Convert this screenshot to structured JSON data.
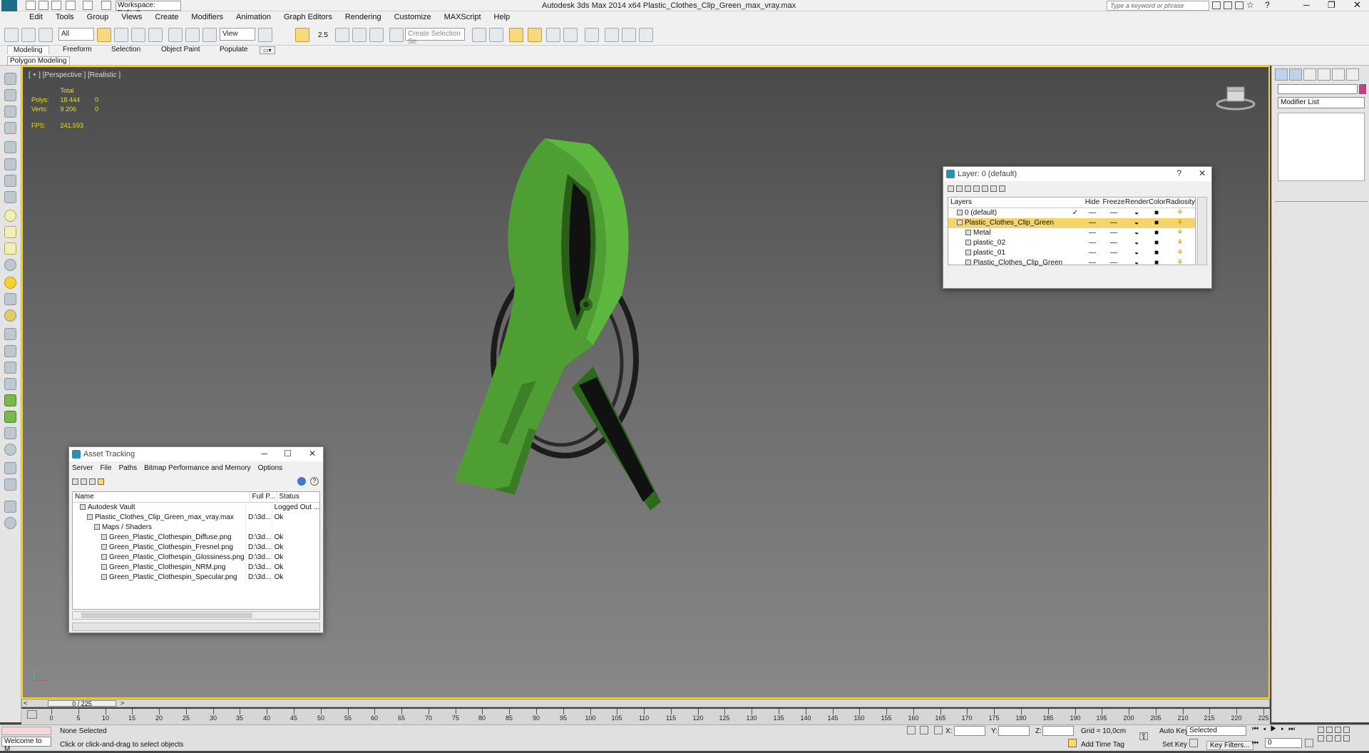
{
  "app": {
    "title": "Autodesk 3ds Max  2014 x64    Plastic_Clothes_Clip_Green_max_vray.max",
    "workspace": "Workspace: Default",
    "search_placeholder": "Type a keyword or phrase"
  },
  "menu": [
    "Edit",
    "Tools",
    "Group",
    "Views",
    "Create",
    "Modifiers",
    "Animation",
    "Graph Editors",
    "Rendering",
    "Customize",
    "MAXScript",
    "Help"
  ],
  "toolbar": {
    "filter": "All",
    "view": "View",
    "snap_label": "2.5",
    "selection_set_placeholder": "Create Selection Se"
  },
  "ribbon": {
    "tabs": [
      "Modeling",
      "Freeform",
      "Selection",
      "Object Paint",
      "Populate"
    ],
    "panel": "Polygon Modeling"
  },
  "viewport": {
    "label": "[ + ] [Perspective ] [Realistic ]",
    "stats": {
      "header": "Total",
      "polys_label": "Polys:",
      "polys_total": "18 444",
      "polys_sel": "0",
      "verts_label": "Verts:",
      "verts_total": "9 206",
      "verts_sel": "0",
      "fps_label": "FPS:",
      "fps": "241,593"
    },
    "colors": {
      "clip": "#4a9e2f",
      "wire": "#222222",
      "background": "#5a5a5a"
    }
  },
  "command_panel": {
    "modifier_list": "Modifier List"
  },
  "layer_window": {
    "title": "Layer: 0 (default)",
    "columns": [
      "Layers",
      "Hide",
      "Freeze",
      "Render",
      "Color",
      "Radiosity"
    ],
    "rows": [
      {
        "name": "0 (default)",
        "indent": 0,
        "checked": true,
        "highlight": false
      },
      {
        "name": "Plastic_Clothes_Clip_Green",
        "indent": 0,
        "checked": false,
        "highlight": true
      },
      {
        "name": "Metal",
        "indent": 1,
        "checked": false,
        "highlight": false
      },
      {
        "name": "plastic_02",
        "indent": 1,
        "checked": false,
        "highlight": false
      },
      {
        "name": "plastic_01",
        "indent": 1,
        "checked": false,
        "highlight": false
      },
      {
        "name": "Plastic_Clothes_Clip_Green",
        "indent": 1,
        "checked": false,
        "highlight": false
      }
    ]
  },
  "asset_window": {
    "title": "Asset Tracking",
    "menu": [
      "Server",
      "File",
      "Paths",
      "Bitmap Performance and Memory",
      "Options"
    ],
    "columns": [
      "Name",
      "Full P...",
      "Status"
    ],
    "rows": [
      {
        "name": "Autodesk Vault",
        "path": "",
        "status": "Logged Out ...",
        "indent": 1
      },
      {
        "name": "Plastic_Clothes_Clip_Green_max_vray.max",
        "path": "D:\\3d...",
        "status": "Ok",
        "indent": 2
      },
      {
        "name": "Maps / Shaders",
        "path": "",
        "status": "",
        "indent": 3
      },
      {
        "name": "Green_Plastic_Clothespin_Diffuse.png",
        "path": "D:\\3d...",
        "status": "Ok",
        "indent": 4
      },
      {
        "name": "Green_Plastic_Clothespin_Fresnel.png",
        "path": "D:\\3d...",
        "status": "Ok",
        "indent": 4
      },
      {
        "name": "Green_Plastic_Clothespin_Glossiness.png",
        "path": "D:\\3d...",
        "status": "Ok",
        "indent": 4
      },
      {
        "name": "Green_Plastic_Clothespin_NRM.png",
        "path": "D:\\3d...",
        "status": "Ok",
        "indent": 4
      },
      {
        "name": "Green_Plastic_Clothespin_Specular.png",
        "path": "D:\\3d...",
        "status": "Ok",
        "indent": 4
      }
    ]
  },
  "timeline": {
    "frame": "0 / 225",
    "ticks": [
      0,
      5,
      10,
      15,
      20,
      25,
      30,
      35,
      40,
      45,
      50,
      55,
      60,
      65,
      70,
      75,
      80,
      85,
      90,
      95,
      100,
      105,
      110,
      115,
      120,
      125,
      130,
      135,
      140,
      145,
      150,
      155,
      160,
      165,
      170,
      175,
      180,
      185,
      190,
      195,
      200,
      205,
      210,
      215,
      220,
      225
    ],
    "max": 225
  },
  "status": {
    "maxscript": "Welcome to M",
    "selection": "None Selected",
    "prompt": "Click or click-and-drag to select objects",
    "x_label": "X:",
    "y_label": "Y:",
    "z_label": "Z:",
    "grid": "Grid = 10,0cm",
    "add_time_tag": "Add Time Tag",
    "auto_key": "Auto Key",
    "set_key": "Set Key",
    "selected": "Selected",
    "key_filters": "Key Filters...",
    "frame_field": "0"
  }
}
